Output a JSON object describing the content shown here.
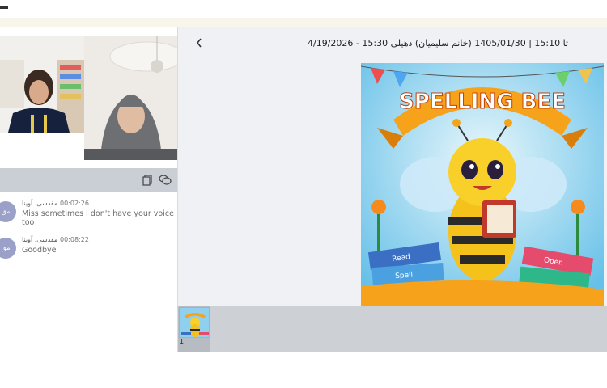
{
  "session": {
    "title": "4/19/2026 - 15:30 تا 15:10 | 1405/01/30 (خانم سلیمیان) دهیلی"
  },
  "toolbar": {
    "back_icon": "chevron-left-icon",
    "copy_icon": "copy-icon",
    "chat_icon": "chat-bubbles-icon"
  },
  "chat": {
    "messages": [
      {
        "avatar": "مق",
        "name": "مقدسی، آوینا",
        "time": "00:02:26",
        "text": "Miss sometimes I don't have your voice too"
      },
      {
        "avatar": "مق",
        "name": "مقدسی، آوینا",
        "time": "00:08:22",
        "text": "Goodbye"
      }
    ]
  },
  "slide": {
    "banner_text": "SPELLING BEE",
    "book1": "Read",
    "book2": "Spell",
    "book3": "Open"
  },
  "thumbnails": [
    {
      "number": "1"
    }
  ],
  "colors": {
    "accent_avatar": "#9aa0c7",
    "toolbar_bg": "#c9cfd5",
    "thumbbar_bg": "#cdd1d6",
    "stage_bg": "#eff1f4"
  }
}
